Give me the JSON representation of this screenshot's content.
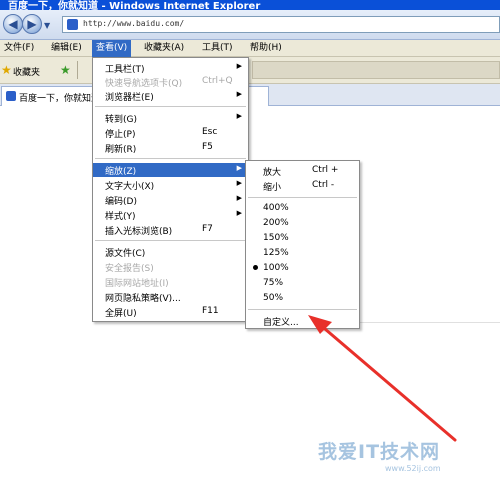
{
  "window": {
    "title": "百度一下，你就知道 - Windows Internet Explorer"
  },
  "addressbar": {
    "url": "http://www.baidu.com/"
  },
  "menubar": {
    "items": [
      "文件(F)",
      "编辑(E)",
      "查看(V)",
      "收藏夹(A)",
      "工具(T)",
      "帮助(H)"
    ]
  },
  "favbar": {
    "favorites_label": "收藏夹"
  },
  "tab": {
    "title": "百度一下，你就知道"
  },
  "view_menu": {
    "items": [
      {
        "label": "工具栏(T)",
        "shortcut": "",
        "submenu": true,
        "disabled": false
      },
      {
        "label": "快速导航选项卡(Q)",
        "shortcut": "Ctrl+Q",
        "submenu": false,
        "disabled": true
      },
      {
        "label": "浏览器栏(E)",
        "shortcut": "",
        "submenu": true,
        "disabled": false
      },
      {
        "label": "转到(G)",
        "shortcut": "",
        "submenu": true,
        "disabled": false
      },
      {
        "label": "停止(P)",
        "shortcut": "Esc",
        "submenu": false,
        "disabled": false
      },
      {
        "label": "刷新(R)",
        "shortcut": "F5",
        "submenu": false,
        "disabled": false
      },
      {
        "label": "缩放(Z)",
        "shortcut": "",
        "submenu": true,
        "disabled": false,
        "highlighted": true
      },
      {
        "label": "文字大小(X)",
        "shortcut": "",
        "submenu": true,
        "disabled": false
      },
      {
        "label": "编码(D)",
        "shortcut": "",
        "submenu": true,
        "disabled": false
      },
      {
        "label": "样式(Y)",
        "shortcut": "",
        "submenu": true,
        "disabled": false
      },
      {
        "label": "插入光标浏览(B)",
        "shortcut": "F7",
        "submenu": false,
        "disabled": false
      },
      {
        "label": "源文件(C)",
        "shortcut": "",
        "submenu": false,
        "disabled": false
      },
      {
        "label": "安全报告(S)",
        "shortcut": "",
        "submenu": false,
        "disabled": true
      },
      {
        "label": "国际网站地址(I)",
        "shortcut": "",
        "submenu": false,
        "disabled": true
      },
      {
        "label": "网页隐私策略(V)...",
        "shortcut": "",
        "submenu": false,
        "disabled": false
      },
      {
        "label": "全屏(U)",
        "shortcut": "F11",
        "submenu": false,
        "disabled": false
      }
    ]
  },
  "zoom_menu": {
    "zoom_in": {
      "label": "放大",
      "shortcut": "Ctrl +"
    },
    "zoom_out": {
      "label": "缩小",
      "shortcut": "Ctrl -"
    },
    "levels": [
      "400%",
      "200%",
      "150%",
      "125%",
      "100%",
      "75%",
      "50%"
    ],
    "selected_level": "100%",
    "custom": "自定义..."
  },
  "watermark": {
    "brand": "我爱IT技术网",
    "site": "www.52ij.com"
  },
  "colors": {
    "highlight": "#316ac5",
    "menu_bg": "#ece9d8",
    "title_bg": "#0a50d8",
    "arrow": "#e8302a"
  }
}
